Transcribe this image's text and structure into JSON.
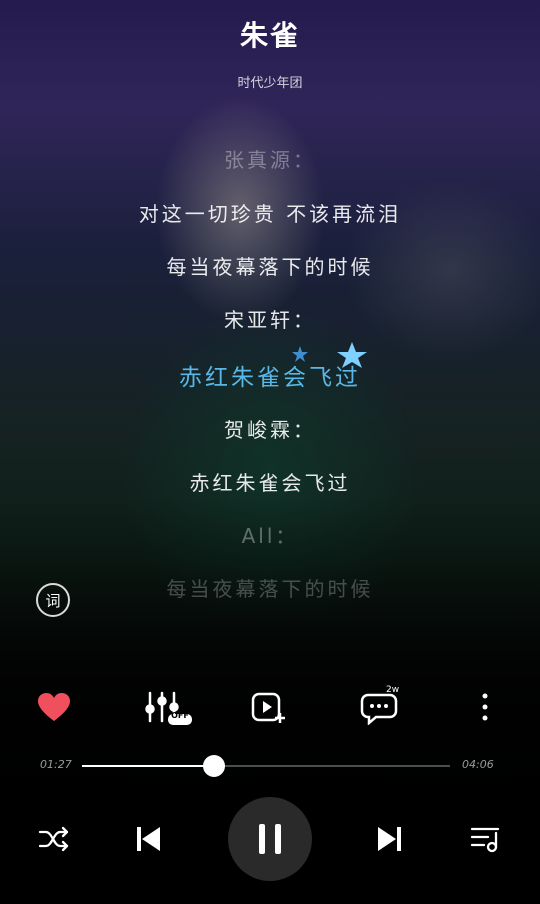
{
  "song": {
    "title": "朱雀",
    "artist": "时代少年团"
  },
  "lyrics": [
    {
      "text": "张真源：",
      "state": "dim"
    },
    {
      "text": "对这一切珍贵 不该再流泪",
      "state": "normal"
    },
    {
      "text": "每当夜幕落下的时候",
      "state": "normal"
    },
    {
      "text": "宋亚轩：",
      "state": "normal"
    },
    {
      "text": "赤红朱雀会飞过",
      "state": "current"
    },
    {
      "text": "贺峻霖：",
      "state": "normal"
    },
    {
      "text": "赤红朱雀会飞过",
      "state": "normal"
    },
    {
      "text": "All：",
      "state": "dim"
    },
    {
      "text": "每当夜幕落下的时候",
      "state": "faint"
    }
  ],
  "lyrics_button_label": "词",
  "actions": {
    "effect_badge": "OFF",
    "comment_count": "2w"
  },
  "player": {
    "elapsed": "01:27",
    "total": "04:06",
    "progress": 0.36
  },
  "colors": {
    "accent": "#59b8e8",
    "like": "#f0505d"
  }
}
